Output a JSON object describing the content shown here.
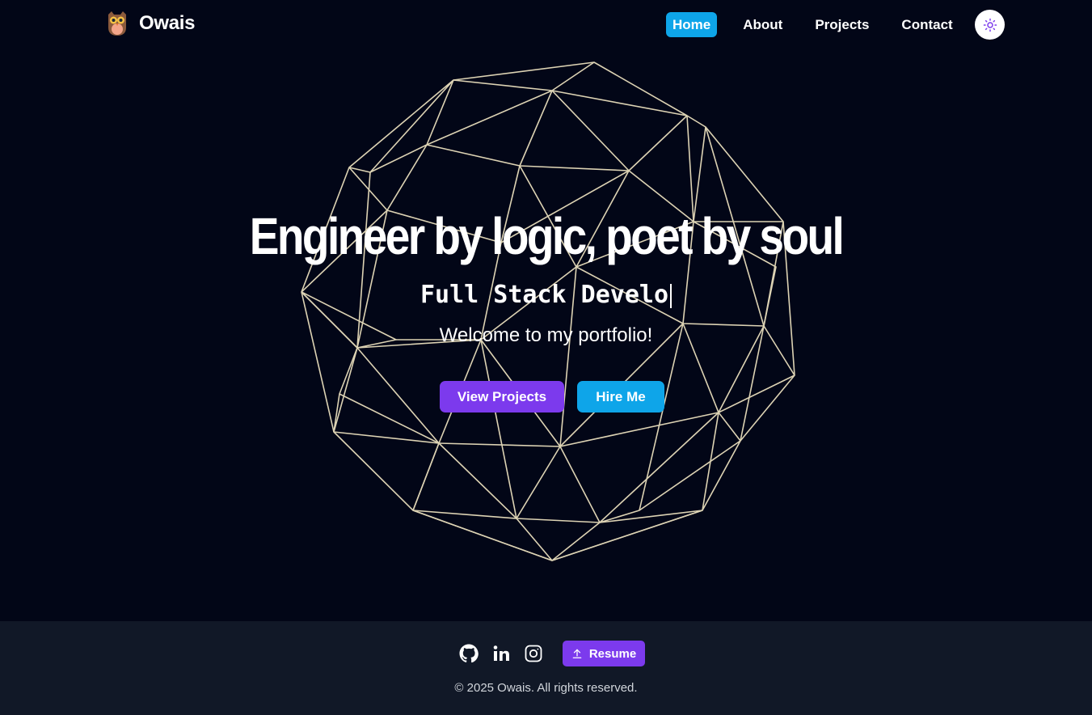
{
  "header": {
    "brand_name": "Owais",
    "logo_icon": "owl-icon",
    "nav": [
      {
        "label": "Home",
        "active": true
      },
      {
        "label": "About",
        "active": false
      },
      {
        "label": "Projects",
        "active": false
      },
      {
        "label": "Contact",
        "active": false
      }
    ],
    "theme_toggle_icon": "sun-icon"
  },
  "hero": {
    "headline": "Engineer by logic, poet by soul",
    "typed_role": "Full Stack Develo",
    "welcome": "Welcome to my portfolio!",
    "primary_button": "View Projects",
    "secondary_button": "Hire Me",
    "background_icon": "wireframe-sphere"
  },
  "footer": {
    "social_icons": [
      "github-icon",
      "linkedin-icon",
      "instagram-icon"
    ],
    "resume_label": "Resume",
    "resume_icon": "upload-icon",
    "copyright": "© 2025 Owais. All rights reserved."
  },
  "colors": {
    "background": "#020617",
    "footer_background": "#111827",
    "accent_blue": "#0ea5e9",
    "accent_purple": "#7c3aed",
    "wireframe": "#ddd3b4"
  }
}
